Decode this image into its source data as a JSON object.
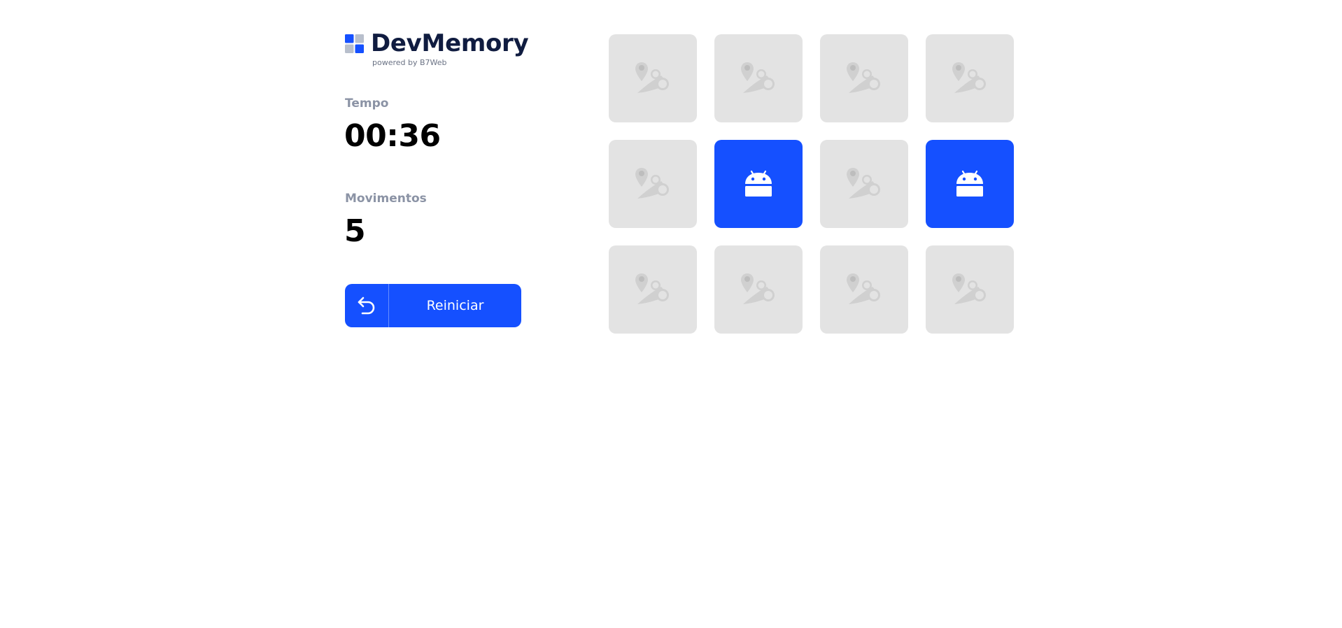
{
  "app": {
    "title": "DevMemory",
    "subtitle": "powered by B7Web"
  },
  "stats": {
    "time_label": "Tempo",
    "time_value": "00:36",
    "moves_label": "Movimentos",
    "moves_value": "5"
  },
  "restart": {
    "label": "Reiniciar",
    "icon": "undo-icon"
  },
  "colors": {
    "accent": "#1550ff",
    "card_hidden": "#e3e3e3",
    "title": "#101c40",
    "label": "#8b93a5"
  },
  "board": {
    "columns": 4,
    "rows": 3,
    "cards": [
      {
        "state": "hidden",
        "icon": "placeholder-logo-icon"
      },
      {
        "state": "hidden",
        "icon": "placeholder-logo-icon"
      },
      {
        "state": "hidden",
        "icon": "placeholder-logo-icon"
      },
      {
        "state": "hidden",
        "icon": "placeholder-logo-icon"
      },
      {
        "state": "hidden",
        "icon": "placeholder-logo-icon"
      },
      {
        "state": "revealed",
        "icon": "android-icon"
      },
      {
        "state": "hidden",
        "icon": "placeholder-logo-icon"
      },
      {
        "state": "revealed",
        "icon": "android-icon"
      },
      {
        "state": "hidden",
        "icon": "placeholder-logo-icon"
      },
      {
        "state": "hidden",
        "icon": "placeholder-logo-icon"
      },
      {
        "state": "hidden",
        "icon": "placeholder-logo-icon"
      },
      {
        "state": "hidden",
        "icon": "placeholder-logo-icon"
      }
    ]
  }
}
